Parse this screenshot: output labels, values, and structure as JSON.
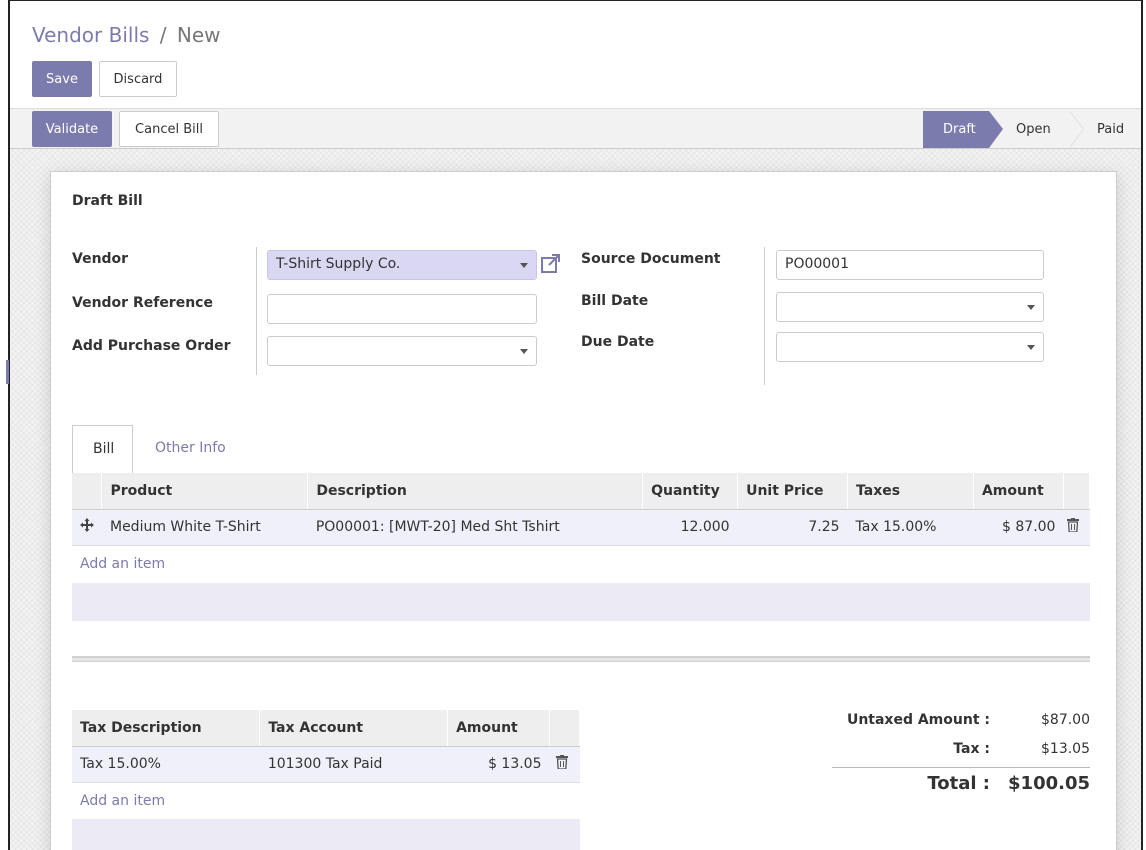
{
  "breadcrumb": {
    "parent": "Vendor Bills",
    "separator": "/",
    "current": "New"
  },
  "toolbar": {
    "save_label": "Save",
    "discard_label": "Discard"
  },
  "statusbar": {
    "validate_label": "Validate",
    "cancel_label": "Cancel Bill",
    "stages": [
      "Draft",
      "Open",
      "Paid"
    ],
    "active_stage": "Draft"
  },
  "colors": {
    "accent": "#7c7bad",
    "row_highlight": "#f0f0fa"
  },
  "form": {
    "title": "Draft Bill",
    "vendor_label": "Vendor",
    "vendor_value": "T-Shirt Supply Co.",
    "vendor_ref_label": "Vendor Reference",
    "vendor_ref_value": "",
    "add_po_label": "Add Purchase Order",
    "add_po_value": "",
    "source_doc_label": "Source Document",
    "source_doc_value": "PO00001",
    "bill_date_label": "Bill Date",
    "bill_date_value": "",
    "due_date_label": "Due Date",
    "due_date_value": ""
  },
  "tabs": [
    {
      "label": "Bill"
    },
    {
      "label": "Other Info"
    }
  ],
  "lines": {
    "headers": [
      "Product",
      "Description",
      "Quantity",
      "Unit Price",
      "Taxes",
      "Amount"
    ],
    "rows": [
      {
        "product": "Medium White T-Shirt",
        "description": "PO00001: [MWT-20] Med Sht Tshirt",
        "quantity": "12.000",
        "unit_price": "7.25",
        "taxes": "Tax 15.00%",
        "amount": "$ 87.00"
      }
    ],
    "add_item": "Add an item"
  },
  "tax_table": {
    "headers": [
      "Tax Description",
      "Tax Account",
      "Amount"
    ],
    "rows": [
      {
        "description": "Tax 15.00%",
        "account": "101300 Tax Paid",
        "amount": "$ 13.05"
      }
    ],
    "add_item": "Add an item"
  },
  "totals": {
    "untaxed_label": "Untaxed Amount :",
    "untaxed_value": "$87.00",
    "tax_label": "Tax :",
    "tax_value": "$13.05",
    "total_label": "Total :",
    "total_value": "$100.05"
  }
}
